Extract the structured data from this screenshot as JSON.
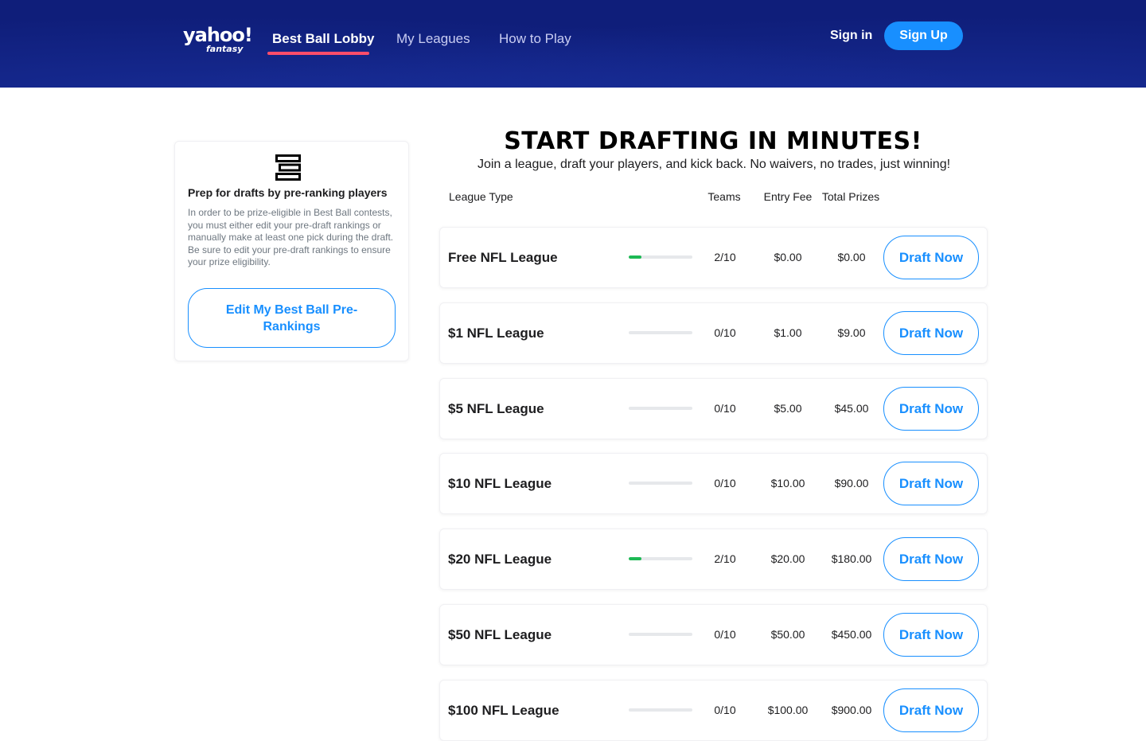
{
  "header": {
    "logo_text": "yahoo!",
    "logo_sub": "fantasy",
    "nav": [
      {
        "label": "Best Ball Lobby",
        "active": true
      },
      {
        "label": "My Leagues",
        "active": false
      },
      {
        "label": "How to Play",
        "active": false
      }
    ],
    "sign_in": "Sign in",
    "sign_up": "Sign Up",
    "colors": {
      "header_bg": "#0f1e7a",
      "accent_blue": "#188fff",
      "active_underline": "#ff4d6a"
    }
  },
  "prep_card": {
    "icon": "rankings-list-icon",
    "title": "Prep for drafts by pre-ranking players",
    "body": "In order to be prize-eligible in Best Ball contests, you must either edit your pre-draft rankings or manually make at least one pick during the draft. Be sure to edit your pre-draft rankings to ensure your prize eligibility.",
    "button": "Edit My Best Ball Pre-Rankings"
  },
  "main": {
    "headline": "START DRAFTING IN MINUTES!",
    "subhead": "Join a league, draft your players, and kick back. No waivers, no trades, just winning!",
    "columns": {
      "league_type": "League Type",
      "teams": "Teams",
      "entry_fee": "Entry Fee",
      "total_prizes": "Total Prizes"
    },
    "leagues": [
      {
        "name": "Free NFL League",
        "teams": "2/10",
        "fill": 0.2,
        "entry_fee": "$0.00",
        "total_prizes": "$0.00",
        "button": "Draft Now"
      },
      {
        "name": "$1 NFL League",
        "teams": "0/10",
        "fill": 0,
        "entry_fee": "$1.00",
        "total_prizes": "$9.00",
        "button": "Draft Now"
      },
      {
        "name": "$5 NFL League",
        "teams": "0/10",
        "fill": 0,
        "entry_fee": "$5.00",
        "total_prizes": "$45.00",
        "button": "Draft Now"
      },
      {
        "name": "$10 NFL League",
        "teams": "0/10",
        "fill": 0,
        "entry_fee": "$10.00",
        "total_prizes": "$90.00",
        "button": "Draft Now"
      },
      {
        "name": "$20 NFL League",
        "teams": "2/10",
        "fill": 0.2,
        "entry_fee": "$20.00",
        "total_prizes": "$180.00",
        "button": "Draft Now"
      },
      {
        "name": "$50 NFL League",
        "teams": "0/10",
        "fill": 0,
        "entry_fee": "$50.00",
        "total_prizes": "$450.00",
        "button": "Draft Now"
      },
      {
        "name": "$100 NFL League",
        "teams": "0/10",
        "fill": 0,
        "entry_fee": "$100.00",
        "total_prizes": "$900.00",
        "button": "Draft Now"
      }
    ]
  }
}
